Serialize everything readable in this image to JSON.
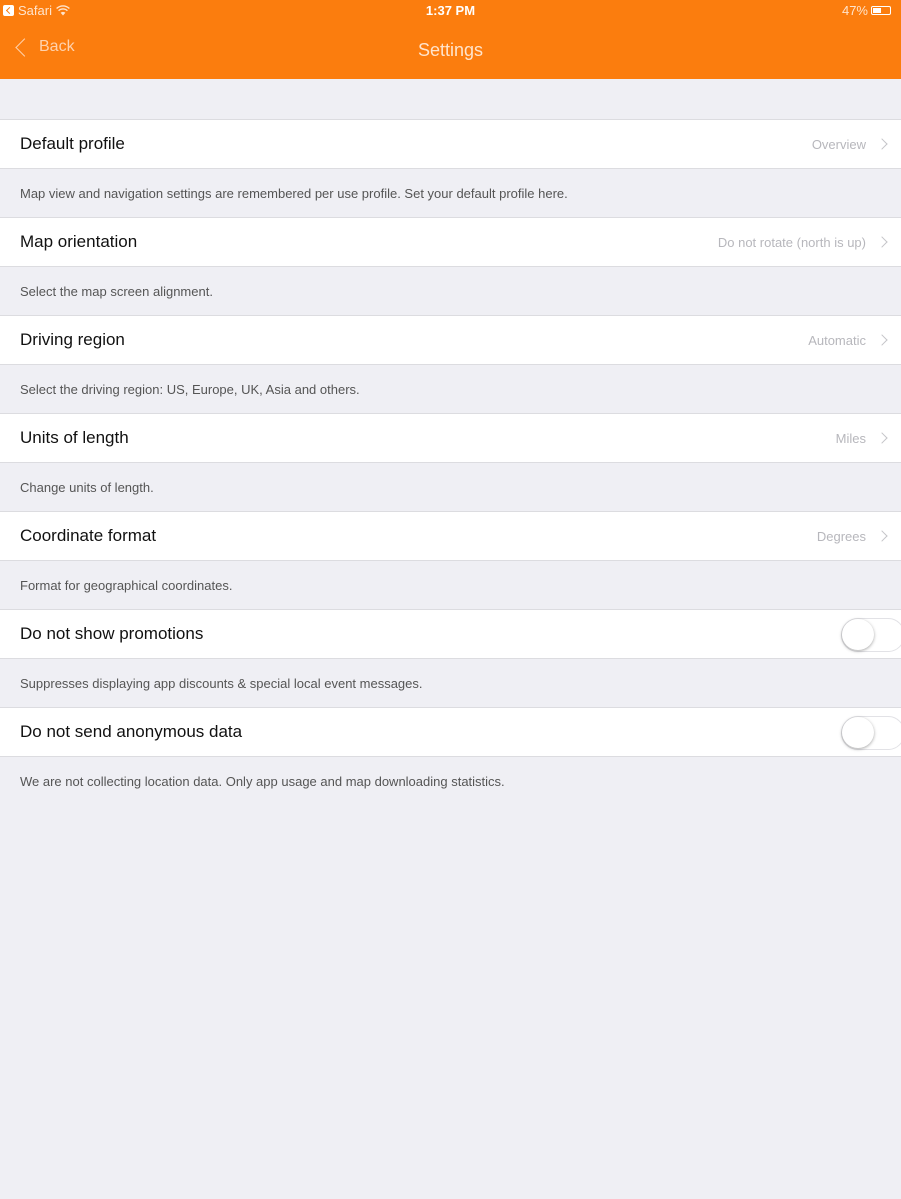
{
  "status_bar": {
    "back_app": "Safari",
    "time": "1:37 PM",
    "battery_percent": "47%",
    "battery_level": 0.47,
    "icons": [
      "back-to-app-icon",
      "wifi-icon",
      "battery-icon"
    ]
  },
  "nav": {
    "back_label": "Back",
    "title": "Settings",
    "bar_color": "#fb7d0e"
  },
  "rows": [
    {
      "label": "Default profile",
      "value": "Overview",
      "description": "Map view and navigation settings are remembered per use profile. Set your default profile here."
    },
    {
      "label": "Map orientation",
      "value": "Do not rotate (north is up)",
      "description": "Select the map screen alignment."
    },
    {
      "label": "Driving region",
      "value": "Automatic",
      "description": "Select the driving region: US, Europe, UK, Asia and others."
    },
    {
      "label": "Units of length",
      "value": "Miles",
      "description": "Change units of length."
    },
    {
      "label": "Coordinate format",
      "value": "Degrees",
      "description": "Format for geographical coordinates."
    },
    {
      "label": "Do not show promotions",
      "toggle_on": false,
      "description": "Suppresses displaying app discounts & special local event messages."
    },
    {
      "label": "Do not send anonymous data",
      "toggle_on": false,
      "description": "We are not collecting location data. Only app usage and map downloading statistics."
    }
  ]
}
